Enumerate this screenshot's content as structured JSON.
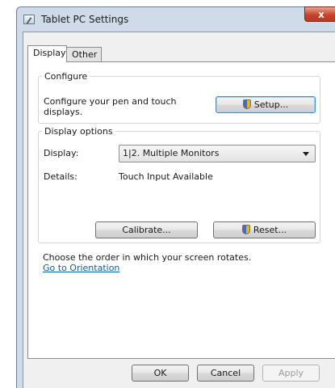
{
  "window": {
    "title": "Tablet PC Settings",
    "close_symbol": "x",
    "icon": "tablet-pc-icon"
  },
  "tabs": [
    {
      "label": "Display",
      "active": true
    },
    {
      "label": "Other",
      "active": false
    }
  ],
  "configure": {
    "legend": "Configure",
    "description_line1": "Configure your pen and touch",
    "description_line2": "displays.",
    "setup_button": "Setup..."
  },
  "display_options": {
    "legend": "Display options",
    "display_label": "Display:",
    "display_value": "1|2. Multiple Monitors",
    "details_label": "Details:",
    "details_value": "Touch Input Available",
    "calibrate_button": "Calibrate...",
    "reset_button": "Reset..."
  },
  "orientation": {
    "text": "Choose the order in which your screen rotates.",
    "link": "Go to Orientation"
  },
  "footer": {
    "ok": "OK",
    "cancel": "Cancel",
    "apply": "Apply"
  },
  "colors": {
    "frame": "#cfdbe9",
    "link": "#0b5fb2",
    "close": "#c7432a"
  }
}
